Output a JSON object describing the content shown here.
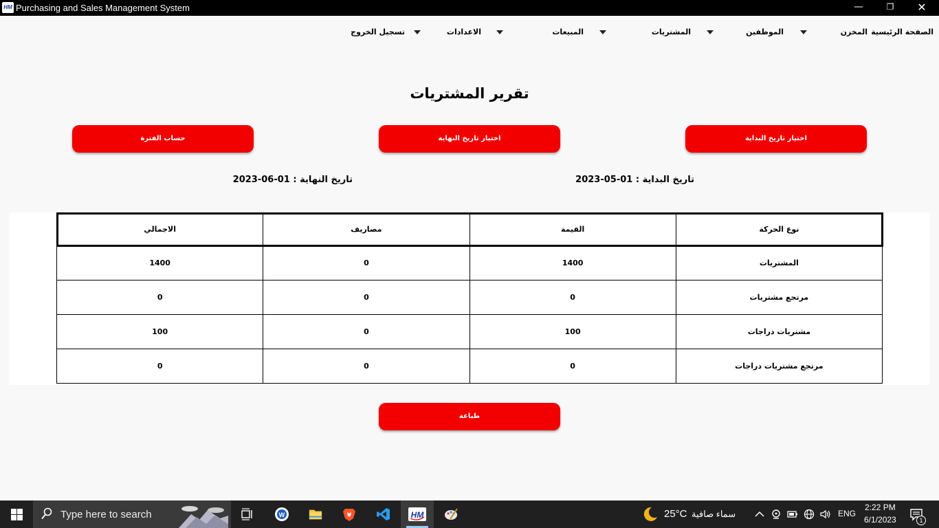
{
  "window": {
    "title": "Purchasing and Sales Management System",
    "app_icon_text": "HM",
    "minimize": "—",
    "maximize": "❐",
    "close": "✕"
  },
  "menu": {
    "home": "الصفحة الرئيسية",
    "warehouse": "المخزن",
    "employees": "الموظفين",
    "purchases": "المشتريات",
    "sales": "المبيعات",
    "settings": "الاعدادات",
    "logout": "تسجيل الخروج"
  },
  "page": {
    "title": "تقرير المشتريات",
    "choose_start_label": "اختيار تاريخ البداية",
    "choose_end_label": "اختيار تاريخ النهاية",
    "calc_period_label": "حساب الفترة",
    "start_date_text": "تاريخ البداية  :  01-05-2023",
    "end_date_text": "تاريخ النهاية  :  01-06-2023",
    "print_label": "طباعة"
  },
  "table": {
    "headers": [
      "نوع الحركة",
      "القيمة",
      "مصاريف",
      "الاجمالي"
    ],
    "rows": [
      [
        "المشتريات",
        "1400",
        "0",
        "1400"
      ],
      [
        "مرتجع مشتريات",
        "0",
        "0",
        "0"
      ],
      [
        "مشتريات دراجات",
        "100",
        "0",
        "100"
      ],
      [
        "مرتجع مشتريات دراجات",
        "0",
        "0",
        "0"
      ]
    ]
  },
  "taskbar": {
    "search_placeholder": "Type here to search",
    "weather_temp": "25°C",
    "weather_desc": "سماء صافية",
    "language": "ENG",
    "time": "2:22 PM",
    "date": "6/1/2023",
    "notification_count": "1",
    "apps": [
      "task-view-icon",
      "word-app-icon",
      "file-explorer-icon",
      "brave-browser-icon",
      "vscode-icon",
      "hm-app-icon",
      "paint-app-icon"
    ]
  },
  "colors": {
    "accent_red": "#f20000",
    "background": "#f8f8f8",
    "titlebar": "#000000",
    "taskbar": "#202020"
  }
}
